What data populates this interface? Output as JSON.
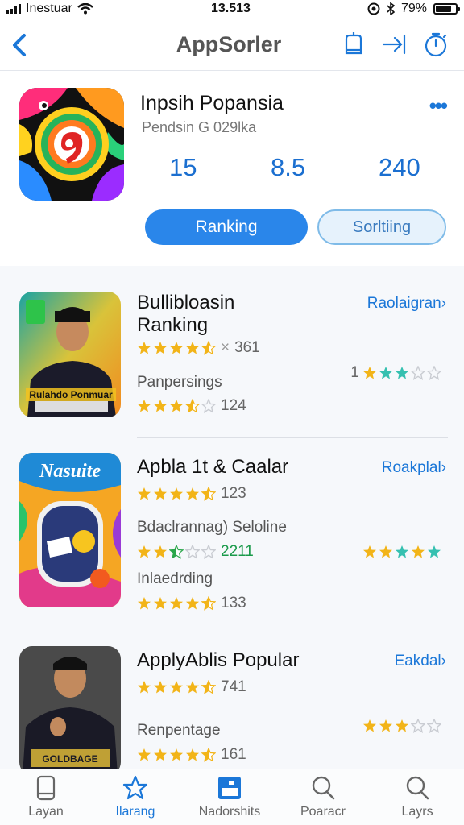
{
  "status_bar": {
    "carrier": "Inestuar",
    "time": "13.513",
    "battery": "79%",
    "battery_level": 0.79
  },
  "nav": {
    "title": "AppSorler"
  },
  "featured": {
    "title": "Inpsih Popansia",
    "subtitle": "Pendsin G 029lka",
    "stats": [
      "15",
      "8.5",
      "240"
    ],
    "primary_button": "Ranking",
    "secondary_button": "Sorltiing"
  },
  "items": [
    {
      "title": "Bullibloasin",
      "title2": "Ranking",
      "link": "Raolaigran",
      "rating1_stars": 4.5,
      "rating1_count": "361",
      "subline": "Panpersings",
      "right_rating_prefix": "1",
      "right_stars": 3,
      "rating2_stars": 3.5,
      "rating2_count": "124",
      "thumb_badge": "Rulahdo Ponmuar"
    },
    {
      "title": "Apbla 1t & Caalar",
      "link": "Roakplal",
      "rating1_stars": 4.5,
      "rating1_count": "123",
      "subline": "Bdaclrannag) Seloline",
      "rating_mid_stars": 2.5,
      "rating_mid_count": "2211",
      "right_stars": 5,
      "subline2": "Inlaedrding",
      "rating2_stars": 4.5,
      "rating2_count": "133",
      "thumb_title": "Nasuite"
    },
    {
      "title": "ApplyAblis Popular",
      "link": "Eakdal",
      "rating1_stars": 4.5,
      "rating1_count": "741",
      "subline": "Renpentage",
      "right_stars": 3,
      "rating2_stars": 4.5,
      "rating2_count": "161",
      "thumb_badge": "GOLDBAGE"
    }
  ],
  "tabs": [
    {
      "label": "Layan",
      "icon": "phone-icon",
      "active": false
    },
    {
      "label": "Ilarang",
      "icon": "star-icon",
      "active": true
    },
    {
      "label": "Nadorshits",
      "icon": "app-icon",
      "active": false
    },
    {
      "label": "Poaracr",
      "icon": "search-icon",
      "active": false
    },
    {
      "label": "Layrs",
      "icon": "search-icon",
      "active": false
    }
  ],
  "colors": {
    "accent": "#1b77d8",
    "star_gold": "#f2b418",
    "star_teal": "#35c0b0"
  }
}
